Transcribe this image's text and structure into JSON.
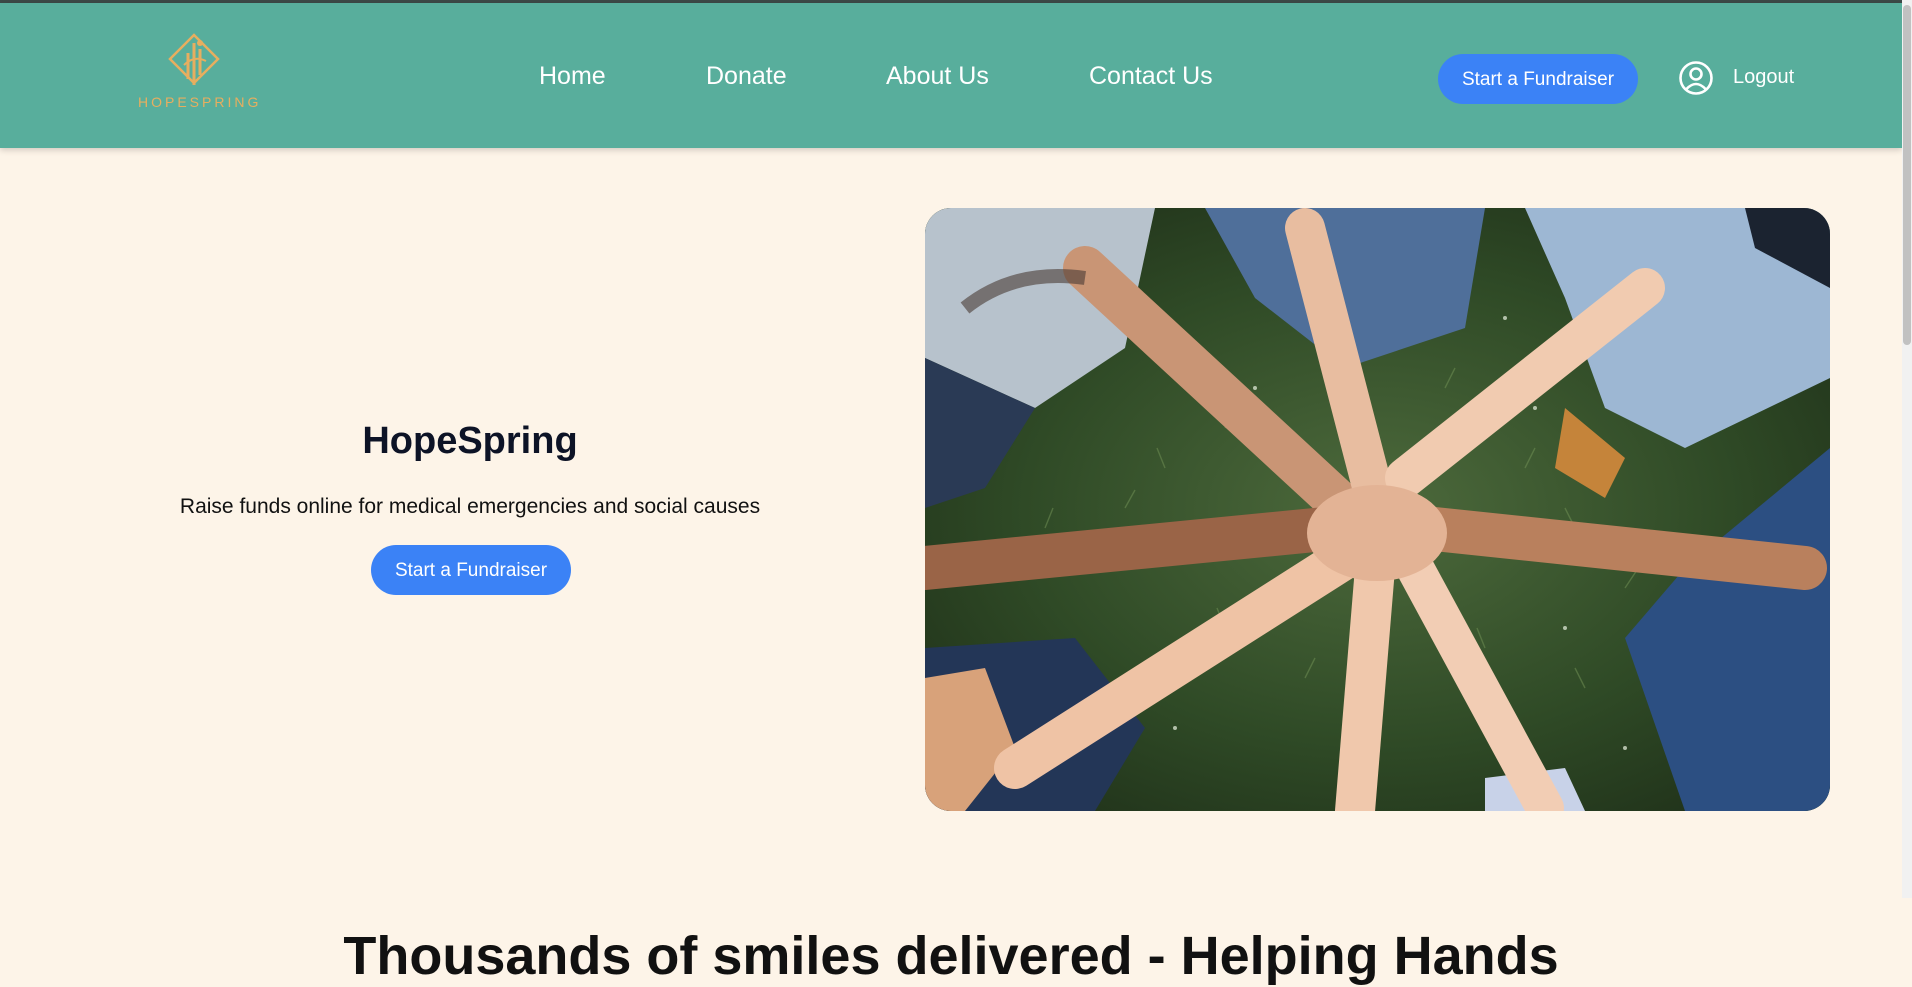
{
  "brand": {
    "name": "HOPESPRING",
    "logo_color": "#e7ae5f"
  },
  "nav": {
    "items": [
      {
        "label": "Home"
      },
      {
        "label": "Donate"
      },
      {
        "label": "About Us"
      },
      {
        "label": "Contact Us"
      }
    ],
    "cta_label": "Start a Fundraiser",
    "user_icon": "user-circle-icon",
    "logout_label": "Logout",
    "background": "#58ae9c"
  },
  "hero": {
    "title": "HopeSpring",
    "subtitle": "Raise funds online for medical emergencies and social causes",
    "cta_label": "Start a Fundraiser"
  },
  "section": {
    "heading": "Thousands of smiles delivered - Helping Hands"
  },
  "colors": {
    "accent": "#3b82f6",
    "page_background": "#fdf4e8"
  }
}
